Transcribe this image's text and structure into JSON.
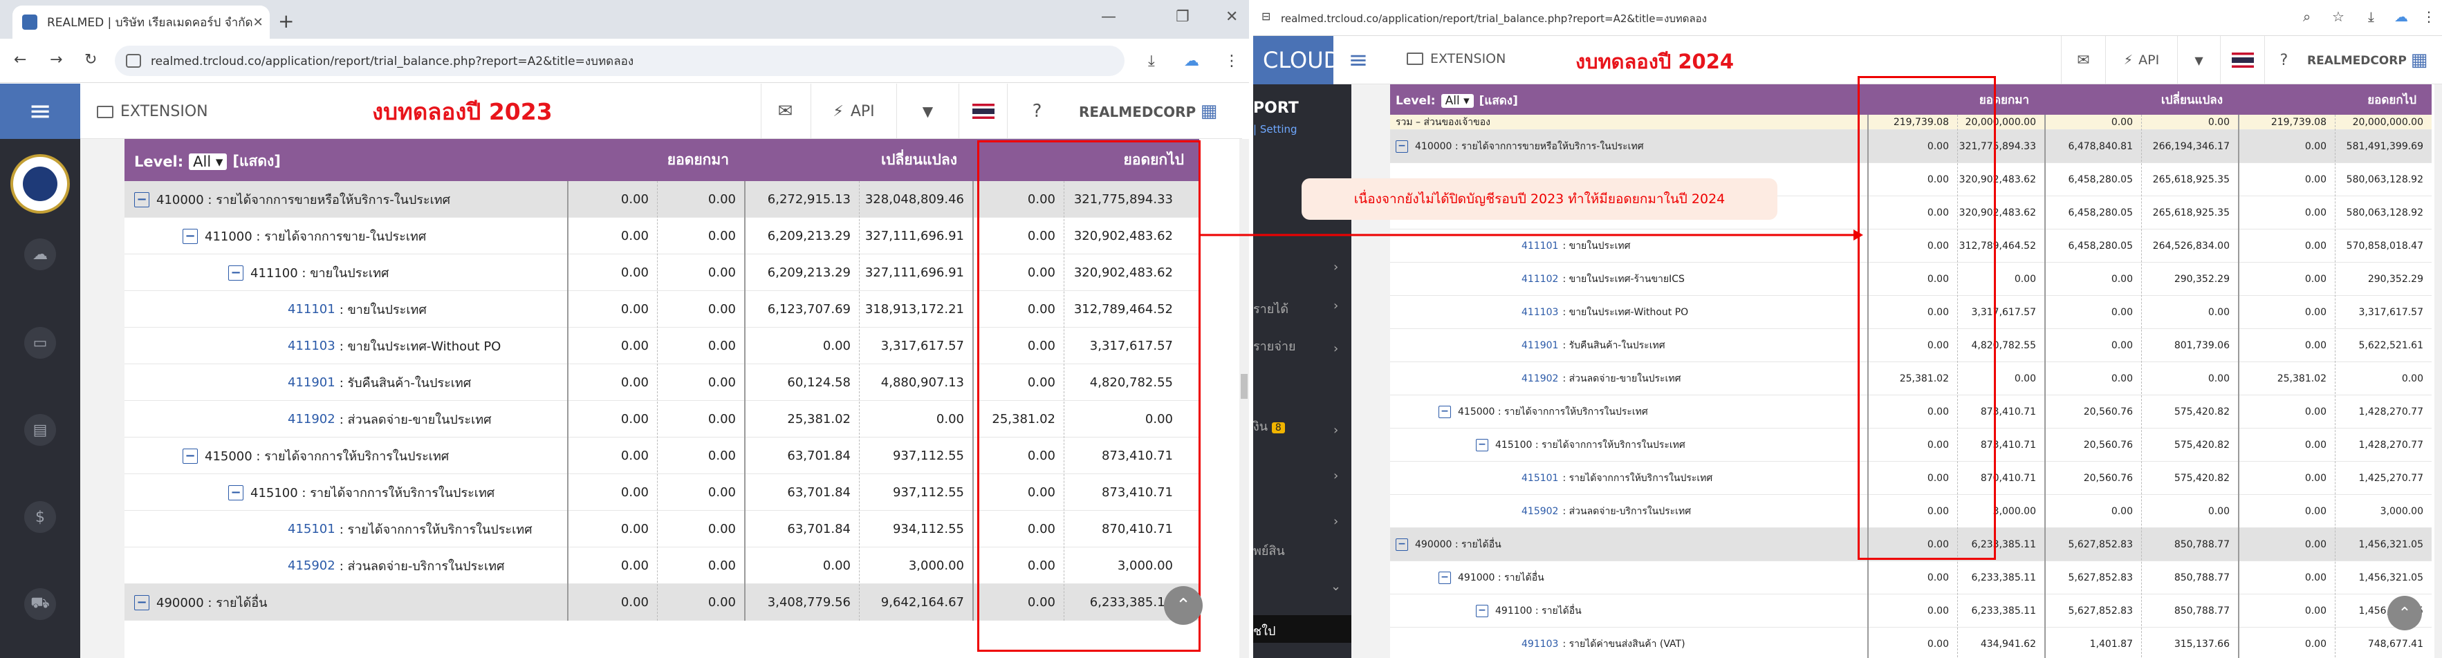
{
  "left": {
    "tab_title": "REALMED | บริษัท เรียลเมดคอร์ป จำกัด",
    "url": "realmed.trcloud.co/application/report/trial_balance.php?report=A2&title=งบทดลอง",
    "extension_label": "EXTENSION",
    "api_label": "API",
    "brand": "REALMEDCORP",
    "annotation": "งบทดลองปี 2023",
    "level_label": "Level:",
    "level_value": "All",
    "show_label": "[แสดง]",
    "col_headers": [
      "ยอดยกมา",
      "เปลี่ยนแปลง",
      "ยอดยกไป"
    ],
    "rows": [
      {
        "label": "410000 : รายได้จากการขายหรือให้บริการ-ในประเทศ",
        "v": [
          "0.00",
          "0.00",
          "6,272,915.13",
          "328,048,809.46",
          "0.00",
          "321,775,894.33"
        ]
      },
      {
        "label": "411000 : รายได้จากการขาย-ในประเทศ",
        "v": [
          "0.00",
          "0.00",
          "6,209,213.29",
          "327,111,696.91",
          "0.00",
          "320,902,483.62"
        ]
      },
      {
        "label": "411100 : ขายในประเทศ",
        "v": [
          "0.00",
          "0.00",
          "6,209,213.29",
          "327,111,696.91",
          "0.00",
          "320,902,483.62"
        ]
      },
      {
        "code": "411101",
        "label": ": ขายในประเทศ",
        "v": [
          "0.00",
          "0.00",
          "6,123,707.69",
          "318,913,172.21",
          "0.00",
          "312,789,464.52"
        ]
      },
      {
        "code": "411103",
        "label": ": ขายในประเทศ-Without PO",
        "v": [
          "0.00",
          "0.00",
          "0.00",
          "3,317,617.57",
          "0.00",
          "3,317,617.57"
        ]
      },
      {
        "code": "411901",
        "label": ": รับคืนสินค้า-ในประเทศ",
        "v": [
          "0.00",
          "0.00",
          "60,124.58",
          "4,880,907.13",
          "0.00",
          "4,820,782.55"
        ]
      },
      {
        "code": "411902",
        "label": ": ส่วนลดจ่าย-ขายในประเทศ",
        "v": [
          "0.00",
          "0.00",
          "25,381.02",
          "0.00",
          "25,381.02",
          "0.00"
        ]
      },
      {
        "label": "415000 : รายได้จากการให้บริการในประเทศ",
        "v": [
          "0.00",
          "0.00",
          "63,701.84",
          "937,112.55",
          "0.00",
          "873,410.71"
        ]
      },
      {
        "label": "415100 : รายได้จากการให้บริการในประเทศ",
        "v": [
          "0.00",
          "0.00",
          "63,701.84",
          "937,112.55",
          "0.00",
          "873,410.71"
        ]
      },
      {
        "code": "415101",
        "label": ": รายได้จากการให้บริการในประเทศ",
        "v": [
          "0.00",
          "0.00",
          "63,701.84",
          "934,112.55",
          "0.00",
          "870,410.71"
        ]
      },
      {
        "code": "415902",
        "label": ": ส่วนลดจ่าย-บริการในประเทศ",
        "v": [
          "0.00",
          "0.00",
          "0.00",
          "3,000.00",
          "0.00",
          "3,000.00"
        ]
      },
      {
        "label": "490000 : รายได้อื่น",
        "v": [
          "0.00",
          "0.00",
          "3,408,779.56",
          "9,642,164.67",
          "0.00",
          "6,233,385.11"
        ]
      }
    ]
  },
  "right": {
    "url": "realmed.trcloud.co/application/report/trial_balance.php?report=A2&title=งบทดลอง",
    "cloud_label": "CLOUD",
    "extension_label": "EXTENSION",
    "api_label": "API",
    "brand": "REALMEDCORP",
    "annotation": "งบทดลองปี 2024",
    "level_label": "Level:",
    "level_value": "All",
    "show_label": "[แสดง]",
    "col_headers": [
      "ยอดยกมา",
      "เปลี่ยนแปลง",
      "ยอดยกไป"
    ],
    "side_items": [
      "PORT",
      "Setting",
      "รายได้",
      "รายจ่าย",
      "งิน",
      "พย์สิน",
      "ชใป"
    ],
    "side_badge": "8",
    "callout": "เนื่องจากยังไม่ได้ปิดบัญชีรอบปี 2023 ทำให้มียอดยกมาในปี 2024",
    "rows": [
      {
        "label": "รวม – ส่วนของเจ้าของ",
        "v": [
          "219,739.08",
          "20,000,000.00",
          "0.00",
          "0.00",
          "219,739.08",
          "20,000,000.00"
        ]
      },
      {
        "label": "410000 : รายได้จากการขายหรือให้บริการ-ในประเทศ",
        "v": [
          "0.00",
          "321,775,894.33",
          "6,478,840.81",
          "266,194,346.17",
          "0.00",
          "581,491,399.69"
        ]
      },
      {
        "label": "",
        "v": [
          "0.00",
          "320,902,483.62",
          "6,458,280.05",
          "265,618,925.35",
          "0.00",
          "580,063,128.92"
        ]
      },
      {
        "label": "411100 : ขายในประเทศ",
        "v": [
          "0.00",
          "320,902,483.62",
          "6,458,280.05",
          "265,618,925.35",
          "0.00",
          "580,063,128.92"
        ]
      },
      {
        "code": "411101",
        "label": ": ขายในประเทศ",
        "v": [
          "0.00",
          "312,789,464.52",
          "6,458,280.05",
          "264,526,834.00",
          "0.00",
          "570,858,018.47"
        ]
      },
      {
        "code": "411102",
        "label": ": ขายในประเทศ-ร้านขายICS",
        "v": [
          "0.00",
          "0.00",
          "0.00",
          "290,352.29",
          "0.00",
          "290,352.29"
        ]
      },
      {
        "code": "411103",
        "label": ": ขายในประเทศ-Without PO",
        "v": [
          "0.00",
          "3,317,617.57",
          "0.00",
          "0.00",
          "0.00",
          "3,317,617.57"
        ]
      },
      {
        "code": "411901",
        "label": ": รับคืนสินค้า-ในประเทศ",
        "v": [
          "0.00",
          "4,820,782.55",
          "0.00",
          "801,739.06",
          "0.00",
          "5,622,521.61"
        ]
      },
      {
        "code": "411902",
        "label": ": ส่วนลดจ่าย-ขายในประเทศ",
        "v": [
          "25,381.02",
          "0.00",
          "0.00",
          "0.00",
          "25,381.02",
          "0.00"
        ]
      },
      {
        "label": "415000 : รายได้จากการให้บริการในประเทศ",
        "v": [
          "0.00",
          "873,410.71",
          "20,560.76",
          "575,420.82",
          "0.00",
          "1,428,270.77"
        ]
      },
      {
        "label": "415100 : รายได้จากการให้บริการในประเทศ",
        "v": [
          "0.00",
          "873,410.71",
          "20,560.76",
          "575,420.82",
          "0.00",
          "1,428,270.77"
        ]
      },
      {
        "code": "415101",
        "label": ": รายได้จากการให้บริการในประเทศ",
        "v": [
          "0.00",
          "870,410.71",
          "20,560.76",
          "575,420.82",
          "0.00",
          "1,425,270.77"
        ]
      },
      {
        "code": "415902",
        "label": ": ส่วนลดจ่าย-บริการในประเทศ",
        "v": [
          "0.00",
          "3,000.00",
          "0.00",
          "0.00",
          "0.00",
          "3,000.00"
        ]
      },
      {
        "label": "490000 : รายได้อื่น",
        "v": [
          "0.00",
          "6,233,385.11",
          "5,627,852.83",
          "850,788.77",
          "0.00",
          "1,456,321.05"
        ]
      },
      {
        "label": "491000 : รายได้อื่น",
        "v": [
          "0.00",
          "6,233,385.11",
          "5,627,852.83",
          "850,788.77",
          "0.00",
          "1,456,321.05"
        ]
      },
      {
        "label": "491100 : รายได้อื่น",
        "v": [
          "0.00",
          "6,233,385.11",
          "5,627,852.83",
          "850,788.77",
          "0.00",
          "1,456,321.05"
        ]
      },
      {
        "code": "491103",
        "label": ": รายได้ค่าขนส่งสินค้า (VAT)",
        "v": [
          "0.00",
          "434,941.62",
          "1,401.87",
          "315,137.66",
          "0.00",
          "748,677.41"
        ]
      }
    ]
  },
  "colors": {
    "header": "#8a5a96",
    "accent_red": "#e8141b",
    "sidebar": "#2b2d35",
    "brand_blue": "#4a72b5"
  }
}
